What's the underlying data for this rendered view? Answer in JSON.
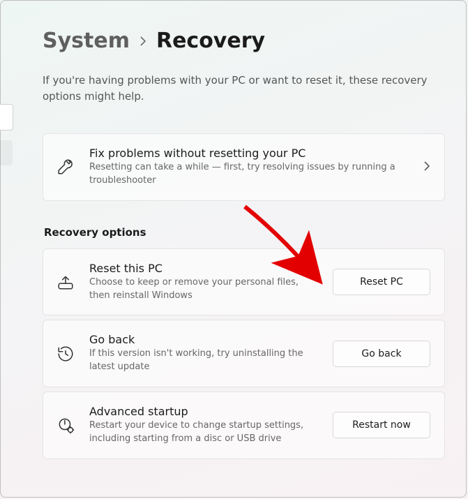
{
  "breadcrumb": {
    "parent": "System",
    "current": "Recovery"
  },
  "intro": "If you're having problems with your PC or want to reset it, these recovery options might help.",
  "fix": {
    "title": "Fix problems without resetting your PC",
    "desc": "Resetting can take a while — first, try resolving issues by running a troubleshooter"
  },
  "section_heading": "Recovery options",
  "reset": {
    "title": "Reset this PC",
    "desc": "Choose to keep or remove your personal files, then reinstall Windows",
    "button": "Reset PC"
  },
  "goback": {
    "title": "Go back",
    "desc": "If this version isn't working, try uninstalling the latest update",
    "button": "Go back"
  },
  "advanced": {
    "title": "Advanced startup",
    "desc": "Restart your device to change startup settings, including starting from a disc or USB drive",
    "button": "Restart now"
  }
}
